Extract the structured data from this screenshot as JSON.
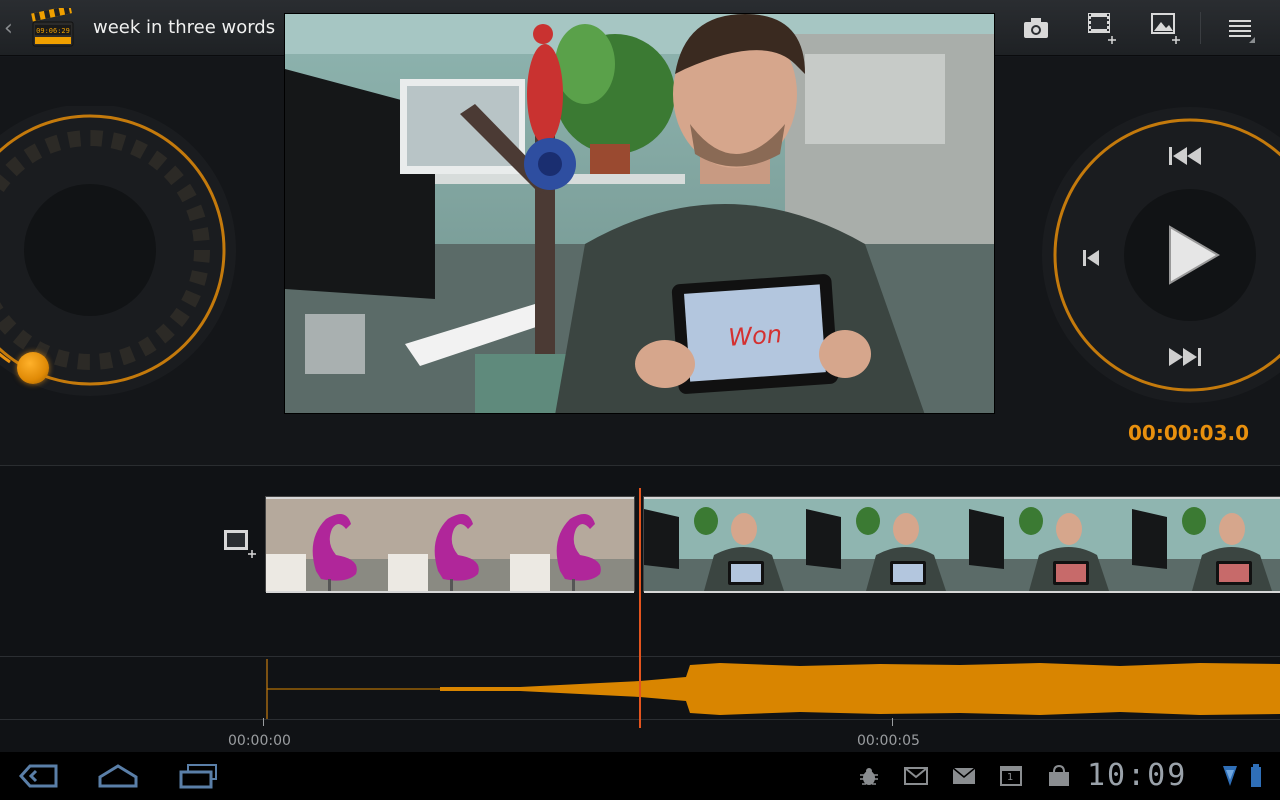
{
  "actionbar": {
    "title": "week in three words",
    "icon_badge": "09:06:29",
    "buttons": [
      {
        "name": "record-video-button",
        "icon": "video-camera-icon"
      },
      {
        "name": "take-photo-button",
        "icon": "camera-icon"
      },
      {
        "name": "add-video-clip-button",
        "icon": "film-add-icon"
      },
      {
        "name": "add-image-button",
        "icon": "image-add-icon"
      },
      {
        "name": "overflow-menu-button",
        "icon": "menu-icon"
      }
    ]
  },
  "preview": {
    "card_text": "Won"
  },
  "playback": {
    "timecode": "00:00:03.0",
    "controls": [
      "rewind-to-start-icon",
      "previous-frame-icon",
      "play-icon",
      "next-frame-icon",
      "fast-forward-to-end-icon"
    ]
  },
  "timeline": {
    "clips": [
      {
        "name": "flamingo-clip",
        "thumbnails": 3
      },
      {
        "name": "won-sign-clip",
        "thumbnails": 4
      }
    ],
    "ruler": [
      {
        "label": "00:00:00"
      },
      {
        "label": "00:00:05"
      }
    ]
  },
  "systembar": {
    "clock": "10:09",
    "nav": [
      "back-icon",
      "home-icon",
      "recent-apps-icon"
    ],
    "status_icons": [
      "usb-debugging-icon",
      "gmail-icon",
      "email-icon",
      "calendar-icon",
      "shopping-bag-icon"
    ],
    "calendar_day": "1"
  },
  "colors": {
    "accent": "#e8900e",
    "playhead": "#e4541e",
    "waveform": "#d98500",
    "background": "#15181c"
  }
}
